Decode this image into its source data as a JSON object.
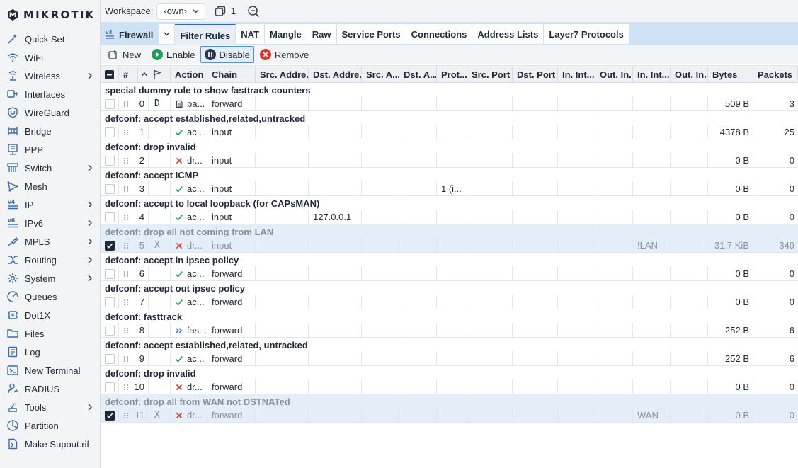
{
  "brand": {
    "name": "MIKROTIK"
  },
  "sidebar": {
    "items": [
      {
        "label": "Quick Set",
        "icon": "quick-set-icon",
        "has_submenu": false
      },
      {
        "label": "WiFi",
        "icon": "wifi-icon",
        "has_submenu": false
      },
      {
        "label": "Wireless",
        "icon": "wireless-icon",
        "has_submenu": true
      },
      {
        "label": "Interfaces",
        "icon": "interfaces-icon",
        "has_submenu": false
      },
      {
        "label": "WireGuard",
        "icon": "wireguard-icon",
        "has_submenu": false
      },
      {
        "label": "Bridge",
        "icon": "bridge-icon",
        "has_submenu": false
      },
      {
        "label": "PPP",
        "icon": "ppp-icon",
        "has_submenu": false
      },
      {
        "label": "Switch",
        "icon": "switch-icon",
        "has_submenu": true
      },
      {
        "label": "Mesh",
        "icon": "mesh-icon",
        "has_submenu": false
      },
      {
        "label": "IP",
        "icon": "ipv4-icon",
        "has_submenu": true
      },
      {
        "label": "IPv6",
        "icon": "ipv6-icon",
        "has_submenu": true
      },
      {
        "label": "MPLS",
        "icon": "mpls-icon",
        "has_submenu": true
      },
      {
        "label": "Routing",
        "icon": "routing-icon",
        "has_submenu": true
      },
      {
        "label": "System",
        "icon": "system-gear-icon",
        "has_submenu": true
      },
      {
        "label": "Queues",
        "icon": "queues-icon",
        "has_submenu": false
      },
      {
        "label": "Dot1X",
        "icon": "dot1x-icon",
        "has_submenu": false
      },
      {
        "label": "Files",
        "icon": "folder-icon",
        "has_submenu": false
      },
      {
        "label": "Log",
        "icon": "log-icon",
        "has_submenu": false
      },
      {
        "label": "New Terminal",
        "icon": "terminal-icon",
        "has_submenu": false
      },
      {
        "label": "RADIUS",
        "icon": "radius-icon",
        "has_submenu": false
      },
      {
        "label": "Tools",
        "icon": "tools-icon",
        "has_submenu": true
      },
      {
        "label": "Partition",
        "icon": "partition-icon",
        "has_submenu": false
      },
      {
        "label": "Make Supout.rif",
        "icon": "supout-icon",
        "has_submenu": false
      }
    ]
  },
  "topbar": {
    "workspace_label": "Workspace:",
    "workspace_value": "‹own›",
    "window_count": "1"
  },
  "tabs": {
    "section_title": "Firewall",
    "items": [
      {
        "label": "Filter Rules",
        "active": true
      },
      {
        "label": "NAT",
        "active": false
      },
      {
        "label": "Mangle",
        "active": false
      },
      {
        "label": "Raw",
        "active": false
      },
      {
        "label": "Service Ports",
        "active": false
      },
      {
        "label": "Connections",
        "active": false
      },
      {
        "label": "Address Lists",
        "active": false
      },
      {
        "label": "Layer7 Protocols",
        "active": false
      }
    ]
  },
  "toolbar": {
    "new_label": "New",
    "enable_label": "Enable",
    "disable_label": "Disable",
    "remove_label": "Remove"
  },
  "table": {
    "columns": [
      "#",
      "Action",
      "Chain",
      "Src. Addre...",
      "Dst. Addre...",
      "Src. A...",
      "Dst. A...",
      "Prot...",
      "Src. Port",
      "Dst. Port",
      "In. Int...",
      "Out. In...",
      "In. Int...",
      "Out. In...",
      "Bytes",
      "Packets"
    ],
    "rows": [
      {
        "comment": "special dummy rule to show fasttrack counters",
        "checked": false,
        "num": "0",
        "flag": "D",
        "action": "pa...",
        "action_icon": "passthrough-doc-icon",
        "chain": "forward",
        "dst_addr": "",
        "protocol": "",
        "in_int_list": "",
        "bytes": "509 B",
        "packets": "3",
        "selected": false
      },
      {
        "comment": "defconf: accept established,related,untracked",
        "checked": false,
        "num": "1",
        "flag": "",
        "action": "ac...",
        "action_icon": "accept-check-icon",
        "chain": "input",
        "dst_addr": "",
        "protocol": "",
        "in_int_list": "",
        "bytes": "4378 B",
        "packets": "25",
        "selected": false
      },
      {
        "comment": "defconf: drop invalid",
        "checked": false,
        "num": "2",
        "flag": "",
        "action": "dr...",
        "action_icon": "drop-x-icon",
        "chain": "input",
        "dst_addr": "",
        "protocol": "",
        "in_int_list": "",
        "bytes": "0 B",
        "packets": "0",
        "selected": false
      },
      {
        "comment": "defconf: accept ICMP",
        "checked": false,
        "num": "3",
        "flag": "",
        "action": "ac...",
        "action_icon": "accept-check-icon",
        "chain": "input",
        "dst_addr": "",
        "protocol": "1 (i...",
        "in_int_list": "",
        "bytes": "0 B",
        "packets": "0",
        "selected": false
      },
      {
        "comment": "defconf: accept to local loopback (for CAPsMAN)",
        "checked": false,
        "num": "4",
        "flag": "",
        "action": "ac...",
        "action_icon": "accept-check-icon",
        "chain": "input",
        "dst_addr": "127.0.0.1",
        "protocol": "",
        "in_int_list": "",
        "bytes": "0 B",
        "packets": "0",
        "selected": false
      },
      {
        "comment": "defconf: drop all not coming from LAN",
        "checked": true,
        "num": "5",
        "flag": "X",
        "action": "dr...",
        "action_icon": "drop-x-icon",
        "chain": "input",
        "dst_addr": "",
        "protocol": "",
        "in_int_list": "!LAN",
        "bytes": "31.7 KiB",
        "packets": "349",
        "selected": true
      },
      {
        "comment": "defconf: accept in ipsec policy",
        "checked": false,
        "num": "6",
        "flag": "",
        "action": "ac...",
        "action_icon": "accept-check-icon",
        "chain": "forward",
        "dst_addr": "",
        "protocol": "",
        "in_int_list": "",
        "bytes": "0 B",
        "packets": "0",
        "selected": false
      },
      {
        "comment": "defconf: accept out ipsec policy",
        "checked": false,
        "num": "7",
        "flag": "",
        "action": "ac...",
        "action_icon": "accept-check-icon",
        "chain": "forward",
        "dst_addr": "",
        "protocol": "",
        "in_int_list": "",
        "bytes": "0 B",
        "packets": "0",
        "selected": false
      },
      {
        "comment": "defconf: fasttrack",
        "checked": false,
        "num": "8",
        "flag": "",
        "action": "fas...",
        "action_icon": "fasttrack-arrows-icon",
        "chain": "forward",
        "dst_addr": "",
        "protocol": "",
        "in_int_list": "",
        "bytes": "252 B",
        "packets": "6",
        "selected": false
      },
      {
        "comment": "defconf: accept established,related, untracked",
        "checked": false,
        "num": "9",
        "flag": "",
        "action": "ac...",
        "action_icon": "accept-check-icon",
        "chain": "forward",
        "dst_addr": "",
        "protocol": "",
        "in_int_list": "",
        "bytes": "252 B",
        "packets": "6",
        "selected": false
      },
      {
        "comment": "defconf: drop invalid",
        "checked": false,
        "num": "10",
        "flag": "",
        "action": "dr...",
        "action_icon": "drop-x-icon",
        "chain": "forward",
        "dst_addr": "",
        "protocol": "",
        "in_int_list": "",
        "bytes": "0 B",
        "packets": "0",
        "selected": false
      },
      {
        "comment": "defconf: drop all from WAN not DSTNATed",
        "checked": true,
        "num": "11",
        "flag": "X",
        "action": "dr...",
        "action_icon": "drop-x-icon",
        "chain": "forward",
        "dst_addr": "",
        "protocol": "",
        "in_int_list": "WAN",
        "bytes": "0 B",
        "packets": "0",
        "selected": true
      }
    ]
  },
  "colors": {
    "accent": "#2f6bb3",
    "tab_bar": "#cfe2f3",
    "selected_row": "#e3eef8",
    "enable_green": "#1e9e5a",
    "remove_red": "#d9342b",
    "disable_blue": "#2f6bb3"
  }
}
